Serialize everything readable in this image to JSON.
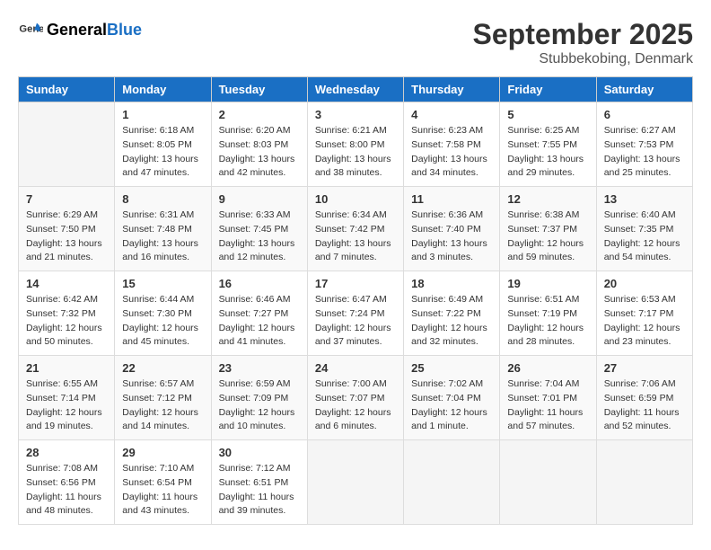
{
  "header": {
    "logo_general": "General",
    "logo_blue": "Blue",
    "month_year": "September 2025",
    "location": "Stubbekobing, Denmark"
  },
  "days_of_week": [
    "Sunday",
    "Monday",
    "Tuesday",
    "Wednesday",
    "Thursday",
    "Friday",
    "Saturday"
  ],
  "weeks": [
    [
      {
        "day": "",
        "info": ""
      },
      {
        "day": "1",
        "info": "Sunrise: 6:18 AM\nSunset: 8:05 PM\nDaylight: 13 hours\nand 47 minutes."
      },
      {
        "day": "2",
        "info": "Sunrise: 6:20 AM\nSunset: 8:03 PM\nDaylight: 13 hours\nand 42 minutes."
      },
      {
        "day": "3",
        "info": "Sunrise: 6:21 AM\nSunset: 8:00 PM\nDaylight: 13 hours\nand 38 minutes."
      },
      {
        "day": "4",
        "info": "Sunrise: 6:23 AM\nSunset: 7:58 PM\nDaylight: 13 hours\nand 34 minutes."
      },
      {
        "day": "5",
        "info": "Sunrise: 6:25 AM\nSunset: 7:55 PM\nDaylight: 13 hours\nand 29 minutes."
      },
      {
        "day": "6",
        "info": "Sunrise: 6:27 AM\nSunset: 7:53 PM\nDaylight: 13 hours\nand 25 minutes."
      }
    ],
    [
      {
        "day": "7",
        "info": "Sunrise: 6:29 AM\nSunset: 7:50 PM\nDaylight: 13 hours\nand 21 minutes."
      },
      {
        "day": "8",
        "info": "Sunrise: 6:31 AM\nSunset: 7:48 PM\nDaylight: 13 hours\nand 16 minutes."
      },
      {
        "day": "9",
        "info": "Sunrise: 6:33 AM\nSunset: 7:45 PM\nDaylight: 13 hours\nand 12 minutes."
      },
      {
        "day": "10",
        "info": "Sunrise: 6:34 AM\nSunset: 7:42 PM\nDaylight: 13 hours\nand 7 minutes."
      },
      {
        "day": "11",
        "info": "Sunrise: 6:36 AM\nSunset: 7:40 PM\nDaylight: 13 hours\nand 3 minutes."
      },
      {
        "day": "12",
        "info": "Sunrise: 6:38 AM\nSunset: 7:37 PM\nDaylight: 12 hours\nand 59 minutes."
      },
      {
        "day": "13",
        "info": "Sunrise: 6:40 AM\nSunset: 7:35 PM\nDaylight: 12 hours\nand 54 minutes."
      }
    ],
    [
      {
        "day": "14",
        "info": "Sunrise: 6:42 AM\nSunset: 7:32 PM\nDaylight: 12 hours\nand 50 minutes."
      },
      {
        "day": "15",
        "info": "Sunrise: 6:44 AM\nSunset: 7:30 PM\nDaylight: 12 hours\nand 45 minutes."
      },
      {
        "day": "16",
        "info": "Sunrise: 6:46 AM\nSunset: 7:27 PM\nDaylight: 12 hours\nand 41 minutes."
      },
      {
        "day": "17",
        "info": "Sunrise: 6:47 AM\nSunset: 7:24 PM\nDaylight: 12 hours\nand 37 minutes."
      },
      {
        "day": "18",
        "info": "Sunrise: 6:49 AM\nSunset: 7:22 PM\nDaylight: 12 hours\nand 32 minutes."
      },
      {
        "day": "19",
        "info": "Sunrise: 6:51 AM\nSunset: 7:19 PM\nDaylight: 12 hours\nand 28 minutes."
      },
      {
        "day": "20",
        "info": "Sunrise: 6:53 AM\nSunset: 7:17 PM\nDaylight: 12 hours\nand 23 minutes."
      }
    ],
    [
      {
        "day": "21",
        "info": "Sunrise: 6:55 AM\nSunset: 7:14 PM\nDaylight: 12 hours\nand 19 minutes."
      },
      {
        "day": "22",
        "info": "Sunrise: 6:57 AM\nSunset: 7:12 PM\nDaylight: 12 hours\nand 14 minutes."
      },
      {
        "day": "23",
        "info": "Sunrise: 6:59 AM\nSunset: 7:09 PM\nDaylight: 12 hours\nand 10 minutes."
      },
      {
        "day": "24",
        "info": "Sunrise: 7:00 AM\nSunset: 7:07 PM\nDaylight: 12 hours\nand 6 minutes."
      },
      {
        "day": "25",
        "info": "Sunrise: 7:02 AM\nSunset: 7:04 PM\nDaylight: 12 hours\nand 1 minute."
      },
      {
        "day": "26",
        "info": "Sunrise: 7:04 AM\nSunset: 7:01 PM\nDaylight: 11 hours\nand 57 minutes."
      },
      {
        "day": "27",
        "info": "Sunrise: 7:06 AM\nSunset: 6:59 PM\nDaylight: 11 hours\nand 52 minutes."
      }
    ],
    [
      {
        "day": "28",
        "info": "Sunrise: 7:08 AM\nSunset: 6:56 PM\nDaylight: 11 hours\nand 48 minutes."
      },
      {
        "day": "29",
        "info": "Sunrise: 7:10 AM\nSunset: 6:54 PM\nDaylight: 11 hours\nand 43 minutes."
      },
      {
        "day": "30",
        "info": "Sunrise: 7:12 AM\nSunset: 6:51 PM\nDaylight: 11 hours\nand 39 minutes."
      },
      {
        "day": "",
        "info": ""
      },
      {
        "day": "",
        "info": ""
      },
      {
        "day": "",
        "info": ""
      },
      {
        "day": "",
        "info": ""
      }
    ]
  ]
}
